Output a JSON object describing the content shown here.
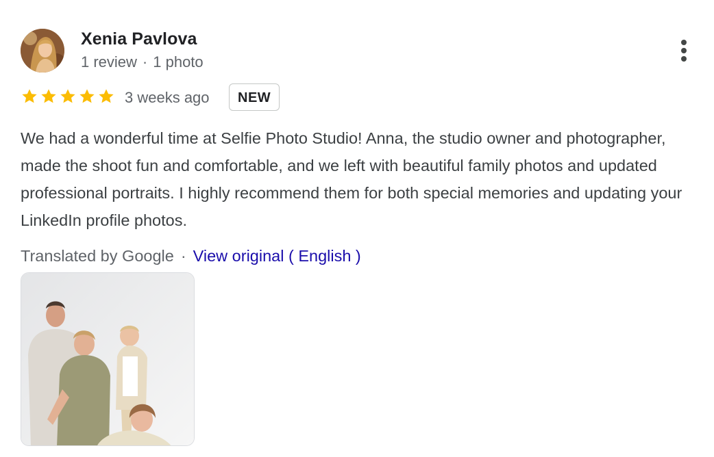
{
  "reviewer": {
    "name": "Xenia Pavlova",
    "review_count": "1 review",
    "separator": "·",
    "photo_count": "1 photo"
  },
  "rating": {
    "stars": 5,
    "max_stars": 5,
    "star_color": "#fbbc04",
    "time_ago": "3 weeks ago",
    "badge": "NEW"
  },
  "review": {
    "text": "We had a wonderful time at Selfie Photo Studio! Anna, the studio owner and photographer, made the shoot fun and comfortable, and we left with beautiful family photos and updated professional portraits. I highly recommend them for both special memories and updating your LinkedIn profile photos."
  },
  "translation": {
    "translated_by": "Translated by Google",
    "separator": "·",
    "view_original": "View original ( English )"
  },
  "icons": {
    "more": "more-vert-icon",
    "star": "star-icon"
  },
  "colors": {
    "link": "#1a0dab",
    "secondary_text": "#5f6368",
    "body_text": "#3c4043"
  }
}
